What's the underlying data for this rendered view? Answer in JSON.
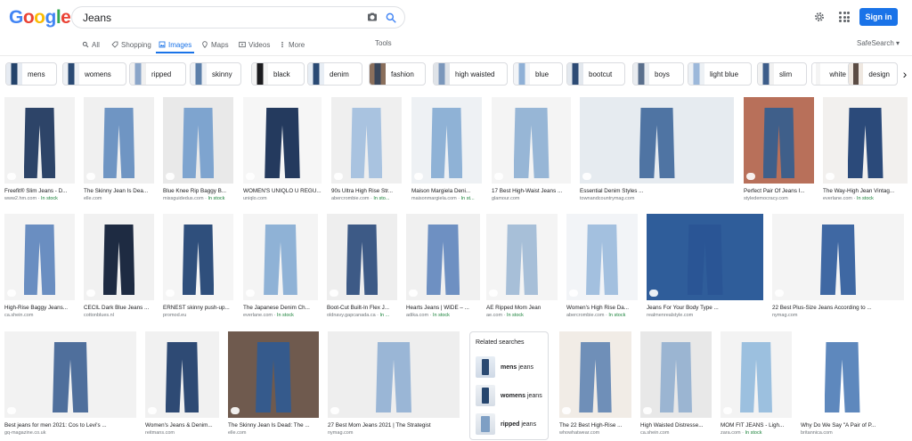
{
  "logo": [
    "G",
    "o",
    "o",
    "g",
    "l",
    "e"
  ],
  "search": {
    "query": "Jeans"
  },
  "header": {
    "signin": "Sign in"
  },
  "tabs": [
    {
      "label": "All",
      "icon": "search-icon"
    },
    {
      "label": "Shopping",
      "icon": "tag-icon"
    },
    {
      "label": "Images",
      "icon": "image-icon",
      "active": true
    },
    {
      "label": "Maps",
      "icon": "pin-icon"
    },
    {
      "label": "Videos",
      "icon": "play-icon"
    },
    {
      "label": "More",
      "icon": "more-icon"
    }
  ],
  "tools": "Tools",
  "safesearch": "SafeSearch ▾",
  "chips": [
    "mens",
    "womens",
    "ripped",
    "skinny",
    "black",
    "denim",
    "fashion",
    "high waisted",
    "blue",
    "bootcut",
    "boys",
    "light blue",
    "slim",
    "white",
    "design"
  ],
  "results": [
    {
      "caption": "Freefit® Slim Jeans - D...",
      "source": "www2.hm.com",
      "stock": "In stock"
    },
    {
      "caption": "The Skinny Jean Is Dea...",
      "source": "elle.com",
      "stock": ""
    },
    {
      "caption": "Blue Knee Rip Baggy B...",
      "source": "missguidedus.com",
      "stock": "In stock"
    },
    {
      "caption": "WOMEN'S UNIQLO U REGU...",
      "source": "uniqlo.com",
      "stock": ""
    },
    {
      "caption": "90s Ultra High Rise Str...",
      "source": "abercrombie.com",
      "stock": "In sto..."
    },
    {
      "caption": "Maison Margiela Deni...",
      "source": "maisonmargiela.com",
      "stock": "In st..."
    },
    {
      "caption": "17 Best High-Waist Jeans ...",
      "source": "glamour.com",
      "stock": ""
    },
    {
      "caption": "Essential Denim Styles ...",
      "source": "townandcountrymag.com",
      "stock": ""
    },
    {
      "caption": "Perfect Pair Of Jeans I...",
      "source": "styledemocracy.com",
      "stock": ""
    },
    {
      "caption": "The Way-High Jean Vintag...",
      "source": "everlane.com",
      "stock": "In stock"
    },
    {
      "caption": "High-Rise Baggy Jeans...",
      "source": "ca.shein.com",
      "stock": ""
    },
    {
      "caption": "CECIL Dark Blue Jeans ...",
      "source": "cottonblues.nl",
      "stock": ""
    },
    {
      "caption": "ERNEST skinny push-up...",
      "source": "promod.eu",
      "stock": ""
    },
    {
      "caption": "The Japanese Denim Ch...",
      "source": "everlane.com",
      "stock": "In stock"
    },
    {
      "caption": "Boot-Cut Built-In Flex J...",
      "source": "oldnavy.gapcanada.ca",
      "stock": "In ..."
    },
    {
      "caption": "Hearts Jeans | WIDE – ...",
      "source": "adika.com",
      "stock": "In stock"
    },
    {
      "caption": "AE Ripped Mom Jean",
      "source": "ae.com",
      "stock": "In stock"
    },
    {
      "caption": "Women's High Rise Da...",
      "source": "abercrombie.com",
      "stock": "In stock"
    },
    {
      "caption": "Jeans For Your Body Type ...",
      "source": "realmenrealstyle.com",
      "stock": ""
    },
    {
      "caption": "22 Best Plus-Size Jeans According to ...",
      "source": "nymag.com",
      "stock": ""
    },
    {
      "caption": "Best jeans for men 2021: Cos to Levi's ...",
      "source": "gq-magazine.co.uk",
      "stock": ""
    },
    {
      "caption": "Women's Jeans & Denim...",
      "source": "reitmans.com",
      "stock": ""
    },
    {
      "caption": "The Skinny Jean Is Dead: The ...",
      "source": "elle.com",
      "stock": ""
    },
    {
      "caption": "27 Best Mom Jeans 2021 | The Strategist",
      "source": "nymag.com",
      "stock": ""
    },
    {
      "caption": "The 22 Best High-Rise ...",
      "source": "whowhatwear.com",
      "stock": ""
    },
    {
      "caption": "High Waisted Distresse...",
      "source": "ca.shein.com",
      "stock": ""
    },
    {
      "caption": "MOM FIT JEANS - Ligh...",
      "source": "zara.com",
      "stock": "In stock"
    },
    {
      "caption": "Why Do We Say \"A Pair of P...",
      "source": "britannica.com",
      "stock": ""
    }
  ],
  "related": {
    "title": "Related searches",
    "items": [
      {
        "bold": "mens",
        "rest": " jeans"
      },
      {
        "bold": "womens",
        "rest": " jeans"
      },
      {
        "bold": "ripped",
        "rest": " jeans"
      }
    ]
  }
}
